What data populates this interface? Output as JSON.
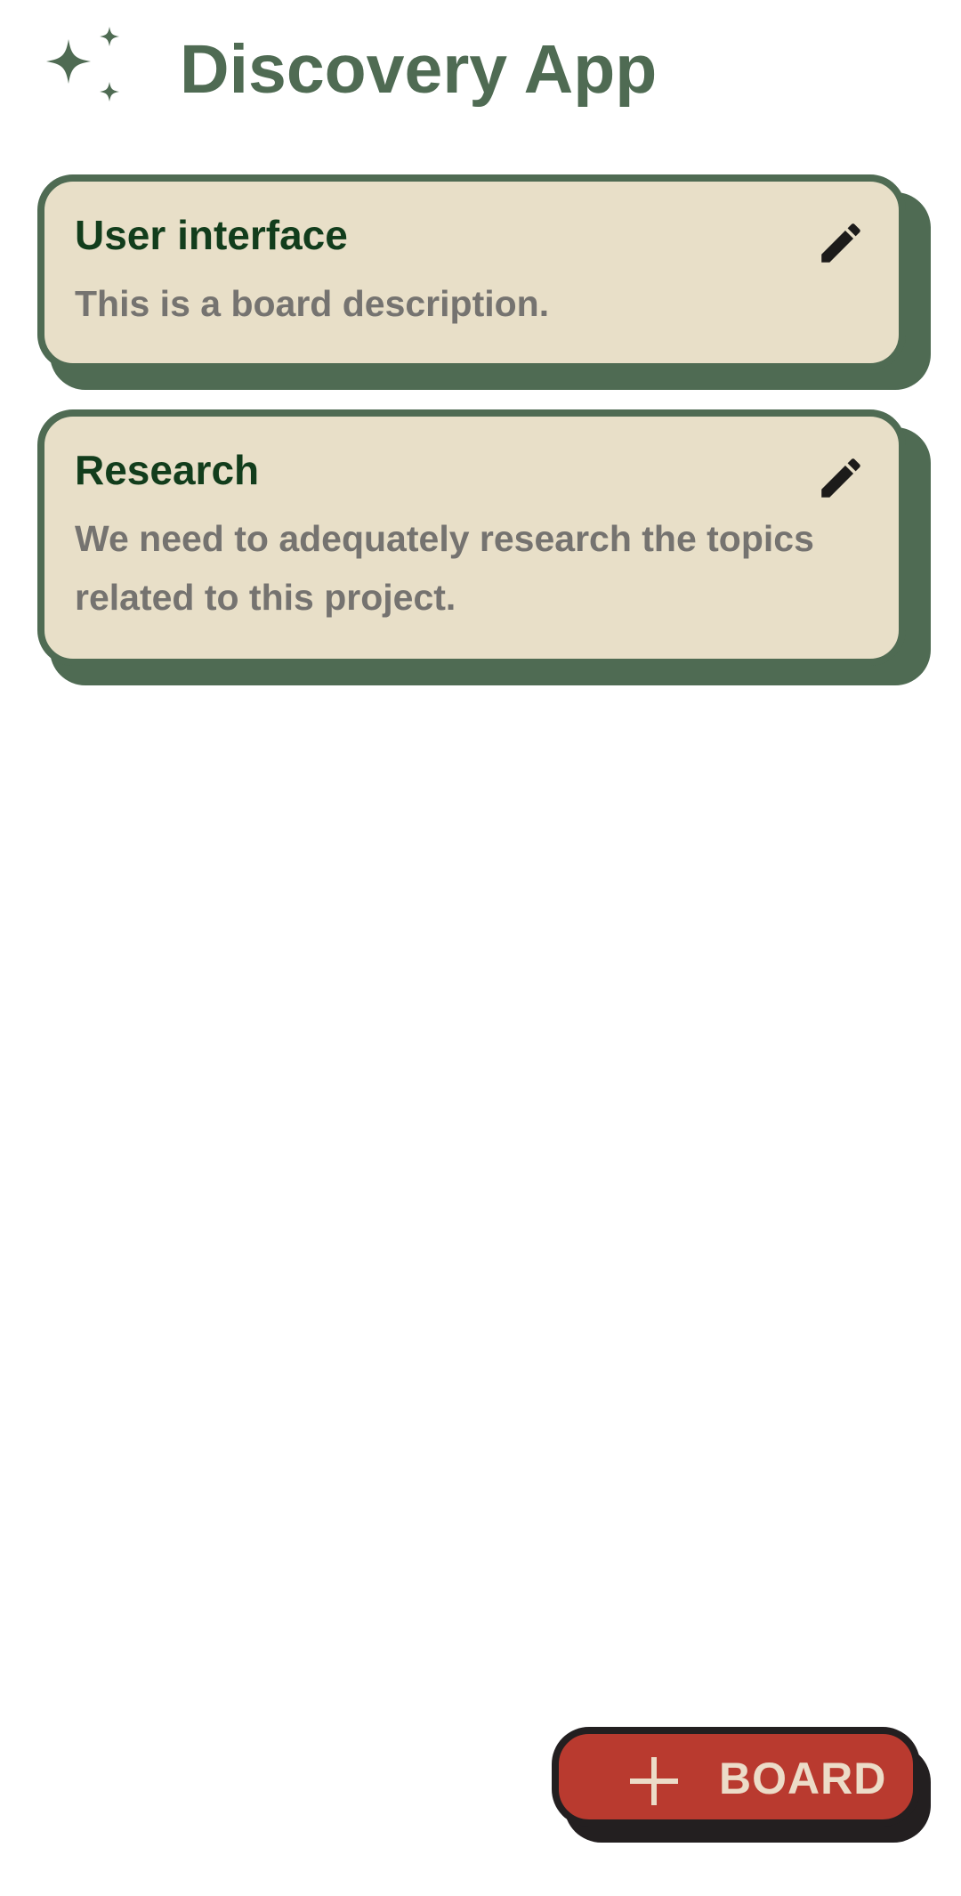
{
  "header": {
    "icon": "sparkles-icon",
    "title": "Discovery App",
    "accent_color": "#4f6b53"
  },
  "boards": [
    {
      "title": "User interface",
      "description": "This is a board description.",
      "edit_icon": "pencil-icon"
    },
    {
      "title": "Research",
      "description": "We need to adequately research the topics related to this project.",
      "edit_icon": "pencil-icon"
    }
  ],
  "fab": {
    "icon": "plus-icon",
    "label": "BOARD",
    "color": "#b93a2f"
  },
  "colors": {
    "card_bg": "#e8dfc8",
    "card_border": "#4f6b53",
    "card_title": "#123d1c",
    "card_desc": "#757370"
  }
}
